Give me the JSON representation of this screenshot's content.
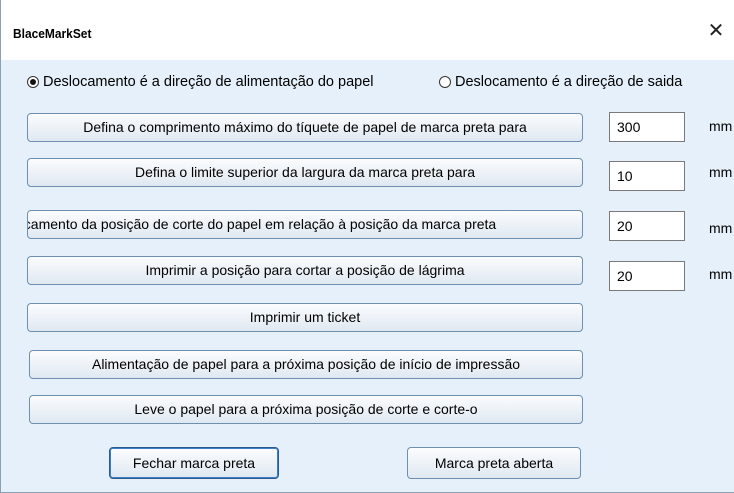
{
  "window": {
    "title": "BlaceMarkSet",
    "close_glyph": "✕"
  },
  "radios": [
    {
      "label": "Deslocamento é a direção de alimentação do papel",
      "checked": true
    },
    {
      "label": "Deslocamento é a direção de saida",
      "checked": false
    }
  ],
  "settings": [
    {
      "button": "Defina o comprimento máximo do tíquete de papel de marca preta para",
      "value": "300",
      "unit": "mm"
    },
    {
      "button": "Defina o limite superior da largura da marca preta para",
      "value": "10",
      "unit": "mm"
    },
    {
      "button": "Deslocamento da posição de corte do papel em relação à posição da marca preta",
      "value": "20",
      "unit": "mm"
    },
    {
      "button": "Imprimir a posição para cortar a posição de lágrima",
      "value": "20",
      "unit": "mm"
    }
  ],
  "actions": {
    "print_ticket": "Imprimir um ticket",
    "feed_next_print": "Alimentação de papel para a próxima posição de início de impressão",
    "feed_next_cut": "Leve o papel para a próxima posição de corte e corte-o",
    "close_black_mark": "Fechar marca preta",
    "open_black_mark": "Marca preta aberta"
  }
}
